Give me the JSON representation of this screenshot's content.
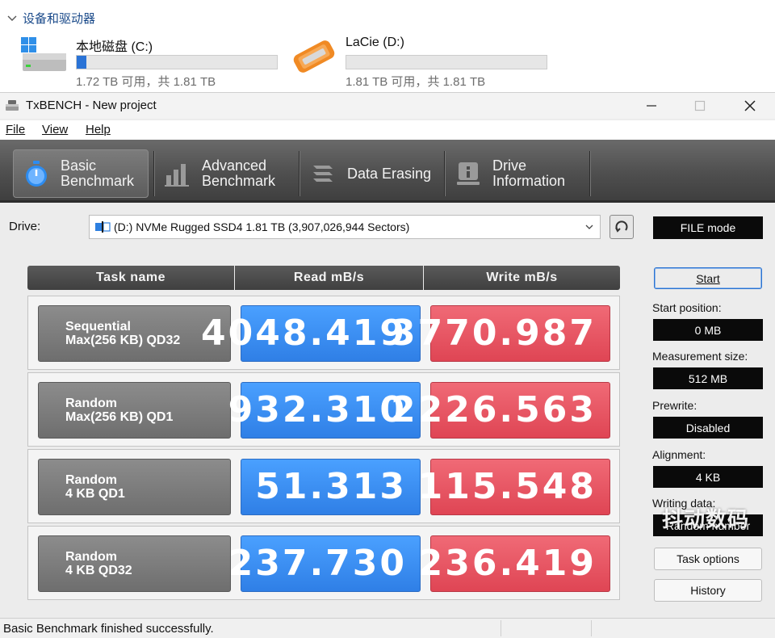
{
  "explorer": {
    "group_title": "设备和驱动器",
    "drives": [
      {
        "name": "本地磁盘 (C:)",
        "space": "1.72 TB 可用，共 1.81 TB",
        "used_fraction": 0.05,
        "icon": "windows-drive-icon"
      },
      {
        "name": "LaCie (D:)",
        "space": "1.81 TB 可用，共 1.81 TB",
        "used_fraction": 0.0,
        "icon": "orange-external-drive-icon"
      }
    ]
  },
  "window": {
    "title": "TxBENCH - New project",
    "menu": {
      "file": "File",
      "view": "View",
      "help": "Help"
    }
  },
  "tabs": {
    "basic": [
      "Basic",
      "Benchmark"
    ],
    "advanced": [
      "Advanced",
      "Benchmark"
    ],
    "erasing": "Data Erasing",
    "info": [
      "Drive",
      "Information"
    ]
  },
  "drive_select": {
    "label": "Drive:",
    "value": "(D:) NVMe Rugged SSD4  1.81 TB (3,907,026,944 Sectors)",
    "mode": "FILE mode"
  },
  "table": {
    "headers": {
      "task": "Task name",
      "read": "Read mB/s",
      "write": "Write mB/s"
    },
    "rows": [
      {
        "task": [
          "Sequential",
          "Max(256 KB) QD32"
        ],
        "read": "4048.419",
        "write": "3770.987"
      },
      {
        "task": [
          "Random",
          "Max(256 KB) QD1"
        ],
        "read": "932.310",
        "write": "2226.563"
      },
      {
        "task": [
          "Random",
          "4 KB QD1"
        ],
        "read": "51.313",
        "write": "115.548"
      },
      {
        "task": [
          "Random",
          "4 KB QD32"
        ],
        "read": "237.730",
        "write": "236.419"
      }
    ]
  },
  "panel": {
    "start": "Start",
    "start_position_label": "Start position:",
    "start_position": "0 MB",
    "measurement_size_label": "Measurement size:",
    "measurement_size": "512 MB",
    "prewrite_label": "Prewrite:",
    "prewrite": "Disabled",
    "alignment_label": "Alignment:",
    "alignment": "4 KB",
    "writing_data_label": "Writing data:",
    "writing_data": "Random number",
    "task_options": "Task options",
    "history": "History"
  },
  "status": {
    "message": "Basic Benchmark finished successfully."
  },
  "watermark": "抖动数码",
  "colors": {
    "read": "#3d8ff5",
    "write": "#e85362",
    "accent": "#2a73d6"
  }
}
